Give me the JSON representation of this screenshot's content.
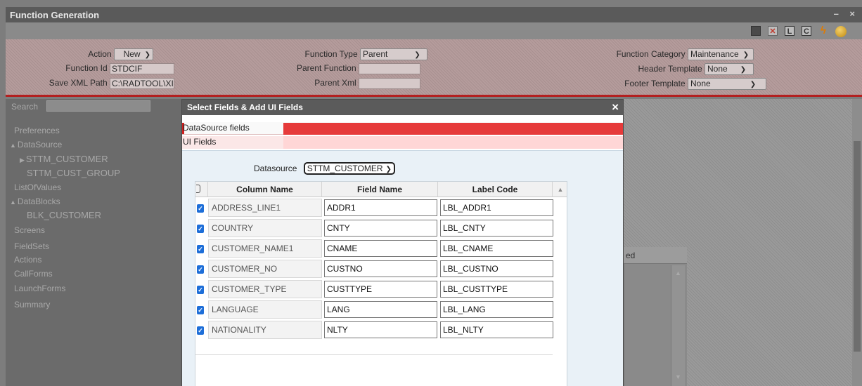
{
  "window": {
    "title": "Function Generation",
    "controls": "– ×"
  },
  "toolbar": {
    "l_label": "L",
    "c_label": "C"
  },
  "header": {
    "action": {
      "label": "Action",
      "value": "New"
    },
    "function_id": {
      "label": "Function Id",
      "value": "STDCIF"
    },
    "save_xml_path": {
      "label": "Save XML Path",
      "value": "C:\\RADTOOL\\XI"
    },
    "function_type": {
      "label": "Function Type",
      "value": "Parent"
    },
    "parent_function": {
      "label": "Parent Function",
      "value": ""
    },
    "parent_xml": {
      "label": "Parent Xml",
      "value": ""
    },
    "function_category": {
      "label": "Function Category",
      "value": "Maintenance"
    },
    "header_template": {
      "label": "Header Template",
      "value": "None"
    },
    "footer_template": {
      "label": "Footer Template",
      "value": "None"
    }
  },
  "sidebar": {
    "search_label": "Search",
    "items": [
      {
        "label": "Preferences"
      },
      {
        "label": "DataSource"
      },
      {
        "label": "STTM_CUSTOMER"
      },
      {
        "label": "STTM_CUST_GROUP"
      },
      {
        "label": "ListOfValues"
      },
      {
        "label": "DataBlocks"
      },
      {
        "label": "BLK_CUSTOMER"
      },
      {
        "label": "Screens"
      },
      {
        "label": "FieldSets"
      },
      {
        "label": "Actions"
      },
      {
        "label": "CallForms"
      },
      {
        "label": "LaunchForms"
      },
      {
        "label": "Summary"
      }
    ]
  },
  "background_panel": {
    "header": "ed"
  },
  "modal": {
    "title": "Select Fields & Add UI Fields",
    "close": "×",
    "tabs": [
      "DataSource fields",
      "UI Fields"
    ],
    "datasource_label": "Datasource",
    "datasource_value": "STTM_CUSTOMER",
    "columns": [
      "Column Name",
      "Field Name",
      "Label Code"
    ],
    "rows": [
      {
        "column": "ADDRESS_LINE1",
        "field": "ADDR1",
        "label": "LBL_ADDR1"
      },
      {
        "column": "COUNTRY",
        "field": "CNTY",
        "label": "LBL_CNTY"
      },
      {
        "column": "CUSTOMER_NAME1",
        "field": "CNAME",
        "label": "LBL_CNAME"
      },
      {
        "column": "CUSTOMER_NO",
        "field": "CUSTNO",
        "label": "LBL_CUSTNO"
      },
      {
        "column": "CUSTOMER_TYPE",
        "field": "CUSTTYPE",
        "label": "LBL_CUSTTYPE"
      },
      {
        "column": "LANGUAGE",
        "field": "LANG",
        "label": "LBL_LANG"
      },
      {
        "column": "NATIONALITY",
        "field": "NLTY",
        "label": "LBL_NLTY"
      }
    ]
  }
}
